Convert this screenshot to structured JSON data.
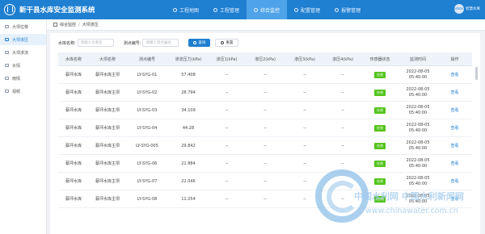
{
  "app": {
    "title": "新干县水库安全监测系统"
  },
  "nav": [
    "工程地图",
    "工程管理",
    "综合监控",
    "配置管理",
    "报警管理"
  ],
  "user": {
    "avatar": "admin",
    "name": "智慧水库"
  },
  "sidebar": [
    "大坝位移",
    "大坝渗压",
    "大坝渗流",
    "水情",
    "雨情",
    "视频"
  ],
  "breadcrumb": {
    "parent": "综合监控",
    "current": "大坝渗压"
  },
  "filters": {
    "reservoir_label": "水库名称:",
    "reservoir_placeholder": "请输入水库名",
    "station_label": "测点编号:",
    "station_placeholder": "请输入测点编号",
    "query": "查询",
    "reset": "重置"
  },
  "table": {
    "headers": [
      "水库名称",
      "大坝名称",
      "测点编号",
      "渗流压力(kPa)",
      "渗压1(kPa)",
      "渗压2(kPa)",
      "渗压3(kPa)",
      "渗压4(kPa)",
      "传感器状态",
      "监测时间",
      "操作"
    ],
    "rows": [
      {
        "reservoir": "蔡坪水库",
        "dam": "蔡坪水库主坝",
        "code": "LY-SYG-01",
        "pressure": "57.408",
        "p1": "--",
        "p2": "--",
        "p3": "--",
        "p4": "--",
        "status": "在线",
        "date": "2022-08-05",
        "time": "05:40:00",
        "action": "查看"
      },
      {
        "reservoir": "蔡坪水库",
        "dam": "蔡坪水库主坝",
        "code": "LY-SYG-02",
        "pressure": "28.794",
        "p1": "--",
        "p2": "--",
        "p3": "--",
        "p4": "--",
        "status": "在线",
        "date": "2022-08-05",
        "time": "05:40:00",
        "action": "查看"
      },
      {
        "reservoir": "蔡坪水库",
        "dam": "蔡坪水库主坝",
        "code": "LY-SYG-03",
        "pressure": "34.109",
        "p1": "--",
        "p2": "--",
        "p3": "--",
        "p4": "--",
        "status": "在线",
        "date": "2022-08-05",
        "time": "05:40:00",
        "action": "查看"
      },
      {
        "reservoir": "蔡坪水库",
        "dam": "蔡坪水库主坝",
        "code": "LY-SYG-04",
        "pressure": "44.28",
        "p1": "--",
        "p2": "--",
        "p3": "--",
        "p4": "--",
        "status": "在线",
        "date": "2022-08-05",
        "time": "05:40:00",
        "action": "查看"
      },
      {
        "reservoir": "蔡坪水库",
        "dam": "蔡坪水库主坝",
        "code": "LY-SYG-005",
        "pressure": "29.842",
        "p1": "--",
        "p2": "--",
        "p3": "--",
        "p4": "--",
        "status": "在线",
        "date": "2022-08-05",
        "time": "05:40:00",
        "action": "查看"
      },
      {
        "reservoir": "蔡坪水库",
        "dam": "蔡坪水库主坝",
        "code": "LY-SYG-06",
        "pressure": "21.884",
        "p1": "--",
        "p2": "--",
        "p3": "--",
        "p4": "--",
        "status": "在线",
        "date": "2022-08-05",
        "time": "05:40:00",
        "action": "查看"
      },
      {
        "reservoir": "蔡坪水库",
        "dam": "蔡坪水库主坝",
        "code": "LY-SYG-07",
        "pressure": "22.046",
        "p1": "--",
        "p2": "--",
        "p3": "--",
        "p4": "--",
        "status": "在线",
        "date": "2022-08-05",
        "time": "05:40:00",
        "action": "查看"
      },
      {
        "reservoir": "蔡坪水库",
        "dam": "蔡坪水库主坝",
        "code": "LY-SYG-08",
        "pressure": "11.254",
        "p1": "--",
        "p2": "--",
        "p3": "--",
        "p4": "--",
        "status": "在线",
        "date": "2022-08-05",
        "time": "05:40:00",
        "action": "查看"
      }
    ]
  },
  "watermark": {
    "name": "中国水利网 中国水利新闻网",
    "url": "www.chinawater.com.cn"
  },
  "colors": {
    "primary": "#1f7fd1",
    "online": "#52c41a",
    "nav_active": "#4fa3e8"
  }
}
